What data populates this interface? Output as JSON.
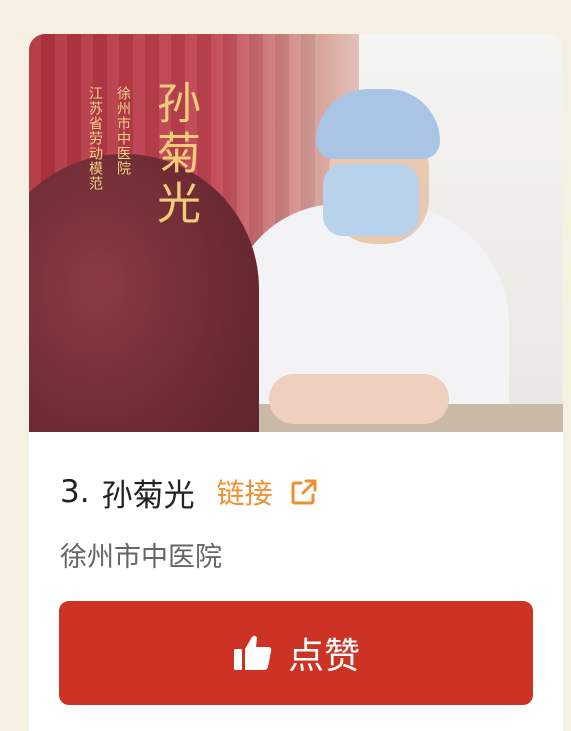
{
  "card": {
    "photo": {
      "vertical_text_1": "江苏省劳动模范",
      "vertical_text_2": "徐州市中医院",
      "calligraphy_name": "孙菊光"
    },
    "entry_number": "3.",
    "name": "孙菊光",
    "link_label": "链接",
    "hospital": "徐州市中医院",
    "like_label": "点赞"
  },
  "colors": {
    "page_bg": "#f6f0e2",
    "accent_red": "#cd3324",
    "link_orange": "#ef8f2e",
    "gold_text": "#f0cc7b"
  },
  "icons": {
    "link": "external-link-icon",
    "like": "thumbs-up-icon"
  }
}
